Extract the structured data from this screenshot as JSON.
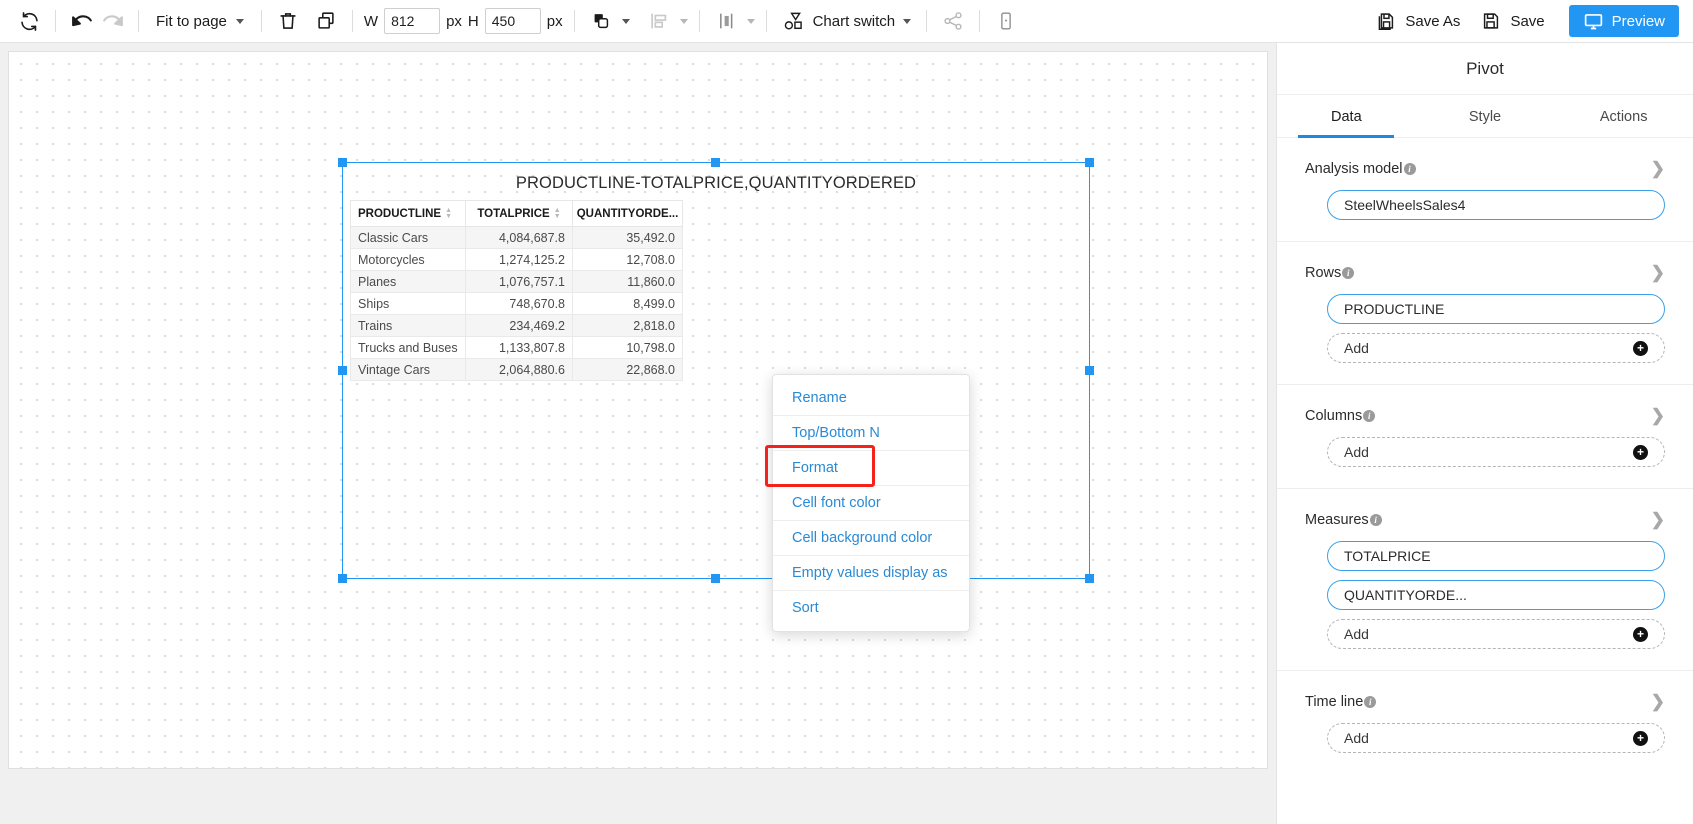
{
  "toolbar": {
    "refresh_icon": "refresh-icon",
    "undo_icon": "undo-icon",
    "redo_icon": "redo-icon",
    "zoom_label": "Fit to page",
    "delete_icon": "trash-icon",
    "copy_icon": "copy-icon",
    "width_label": "W",
    "width_value": "812",
    "width_unit": "px",
    "height_label": "H",
    "height_value": "450",
    "height_unit": "px",
    "arrange_icon": "shapes-overlap-icon",
    "align_icon": "align-left-icon",
    "distribute_icon": "distribute-icon",
    "chart_switch_label": "Chart switch",
    "share_icon": "share-icon",
    "device_icon": "device-preview-icon",
    "save_as_label": "Save As",
    "save_label": "Save",
    "preview_label": "Preview",
    "accent_color": "#2196f3"
  },
  "canvas": {
    "widget": {
      "title": "PRODUCTLINE-TOTALPRICE,QUANTITYORDERED",
      "selected": true,
      "selection_color": "#2196f3"
    }
  },
  "chart_data": {
    "type": "table",
    "title": "PRODUCTLINE-TOTALPRICE,QUANTITYORDERED",
    "columns": [
      "PRODUCTLINE",
      "TOTALPRICE",
      "QUANTITYORDE..."
    ],
    "rows": [
      [
        "Classic Cars",
        "4,084,687.8",
        "35,492.0"
      ],
      [
        "Motorcycles",
        "1,274,125.2",
        "12,708.0"
      ],
      [
        "Planes",
        "1,076,757.1",
        "11,860.0"
      ],
      [
        "Ships",
        "748,670.8",
        "8,499.0"
      ],
      [
        "Trains",
        "234,469.2",
        "2,818.0"
      ],
      [
        "Trucks and Buses",
        "1,133,807.8",
        "10,798.0"
      ],
      [
        "Vintage Cars",
        "2,064,880.6",
        "22,868.0"
      ]
    ],
    "categories": [
      "Classic Cars",
      "Motorcycles",
      "Planes",
      "Ships",
      "Trains",
      "Trucks and Buses",
      "Vintage Cars"
    ],
    "series": [
      {
        "name": "TOTALPRICE",
        "values": [
          4084687.8,
          1274125.2,
          1076757.1,
          748670.8,
          234469.2,
          1133807.8,
          2064880.6
        ]
      },
      {
        "name": "QUANTITYORDERED",
        "values": [
          35492.0,
          12708.0,
          11860.0,
          8499.0,
          2818.0,
          10798.0,
          22868.0
        ]
      }
    ],
    "xlabel": "PRODUCTLINE",
    "ylabel": ""
  },
  "context_menu": {
    "items": [
      {
        "label": "Rename",
        "highlighted": false
      },
      {
        "label": "Top/Bottom N",
        "highlighted": false
      },
      {
        "label": "Format",
        "highlighted": true
      },
      {
        "label": "Cell font color",
        "highlighted": false
      },
      {
        "label": "Cell background color",
        "highlighted": false
      },
      {
        "label": "Empty values display as",
        "highlighted": false
      },
      {
        "label": "Sort",
        "highlighted": false
      }
    ],
    "highlight_color": "#f4221b"
  },
  "panel": {
    "title": "Pivot",
    "tabs": [
      {
        "label": "Data",
        "active": true
      },
      {
        "label": "Style",
        "active": false
      },
      {
        "label": "Actions",
        "active": false
      }
    ],
    "sections": [
      {
        "label": "Analysis model",
        "info_icon": "info-icon",
        "chevron_icon": "chevron-right-icon",
        "pills": [
          {
            "label": "SteelWheelsSales4",
            "type": "value"
          }
        ]
      },
      {
        "label": "Rows",
        "info_icon": "info-icon",
        "chevron_icon": "chevron-right-icon",
        "pills": [
          {
            "label": "PRODUCTLINE",
            "type": "value"
          },
          {
            "label": "Add",
            "type": "add"
          }
        ]
      },
      {
        "label": "Columns",
        "info_icon": "info-icon",
        "chevron_icon": "chevron-right-icon",
        "pills": [
          {
            "label": "Add",
            "type": "add"
          }
        ]
      },
      {
        "label": "Measures",
        "info_icon": "info-icon",
        "chevron_icon": "chevron-right-icon",
        "pills": [
          {
            "label": "TOTALPRICE",
            "type": "value"
          },
          {
            "label": "QUANTITYORDE...",
            "type": "value"
          },
          {
            "label": "Add",
            "type": "add"
          }
        ]
      },
      {
        "label": "Time line",
        "info_icon": "info-icon",
        "chevron_icon": "chevron-right-icon",
        "pills": [
          {
            "label": "Add",
            "type": "add"
          }
        ]
      }
    ],
    "info_char": "i",
    "chevron_char": "❯",
    "plus_char": "+"
  }
}
